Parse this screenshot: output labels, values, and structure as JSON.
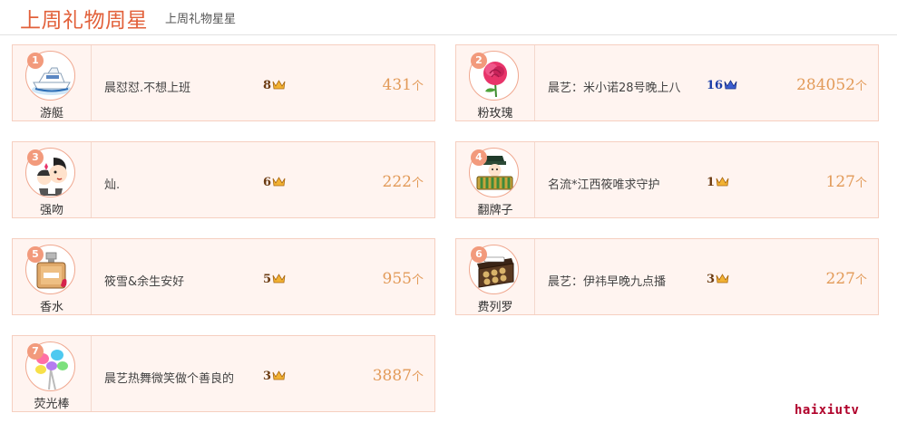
{
  "header": {
    "title": "上周礼物周星",
    "subtitle": "上周礼物星星"
  },
  "colors": {
    "title": "#e2603a",
    "count": "#e29a58",
    "card_bg": "#fff4f0",
    "rank_badge": "#f29a7c"
  },
  "cards": [
    {
      "rank": "1",
      "gift": "游艇",
      "icon": "yacht-icon",
      "user": "晨怼怼.不想上班",
      "level": "8",
      "count": "431",
      "unit": "个"
    },
    {
      "rank": "2",
      "gift": "粉玫瑰",
      "icon": "pink-rose-icon",
      "user": "晨艺：米小诺28号晚上八",
      "level": "16",
      "count": "284052",
      "unit": "个"
    },
    {
      "rank": "3",
      "gift": "强吻",
      "icon": "forced-kiss-icon",
      "user": "灿.",
      "level": "6",
      "count": "222",
      "unit": "个"
    },
    {
      "rank": "4",
      "gift": "翻牌子",
      "icon": "flip-card-icon",
      "user": "名流*江西筱唯求守护",
      "level": "1",
      "count": "127",
      "unit": "个"
    },
    {
      "rank": "5",
      "gift": "香水",
      "icon": "perfume-icon",
      "user": "筱雪&余生安好",
      "level": "5",
      "count": "955",
      "unit": "个"
    },
    {
      "rank": "6",
      "gift": "费列罗",
      "icon": "chocolate-box-icon",
      "user": "晨艺：伊祎早晚九点播",
      "level": "3",
      "count": "227",
      "unit": "个"
    },
    {
      "rank": "7",
      "gift": "荧光棒",
      "icon": "glow-stick-icon",
      "user": "晨艺热舞微笑做个善良的",
      "level": "3",
      "count": "3887",
      "unit": "个"
    }
  ],
  "watermark": "haixiutv"
}
